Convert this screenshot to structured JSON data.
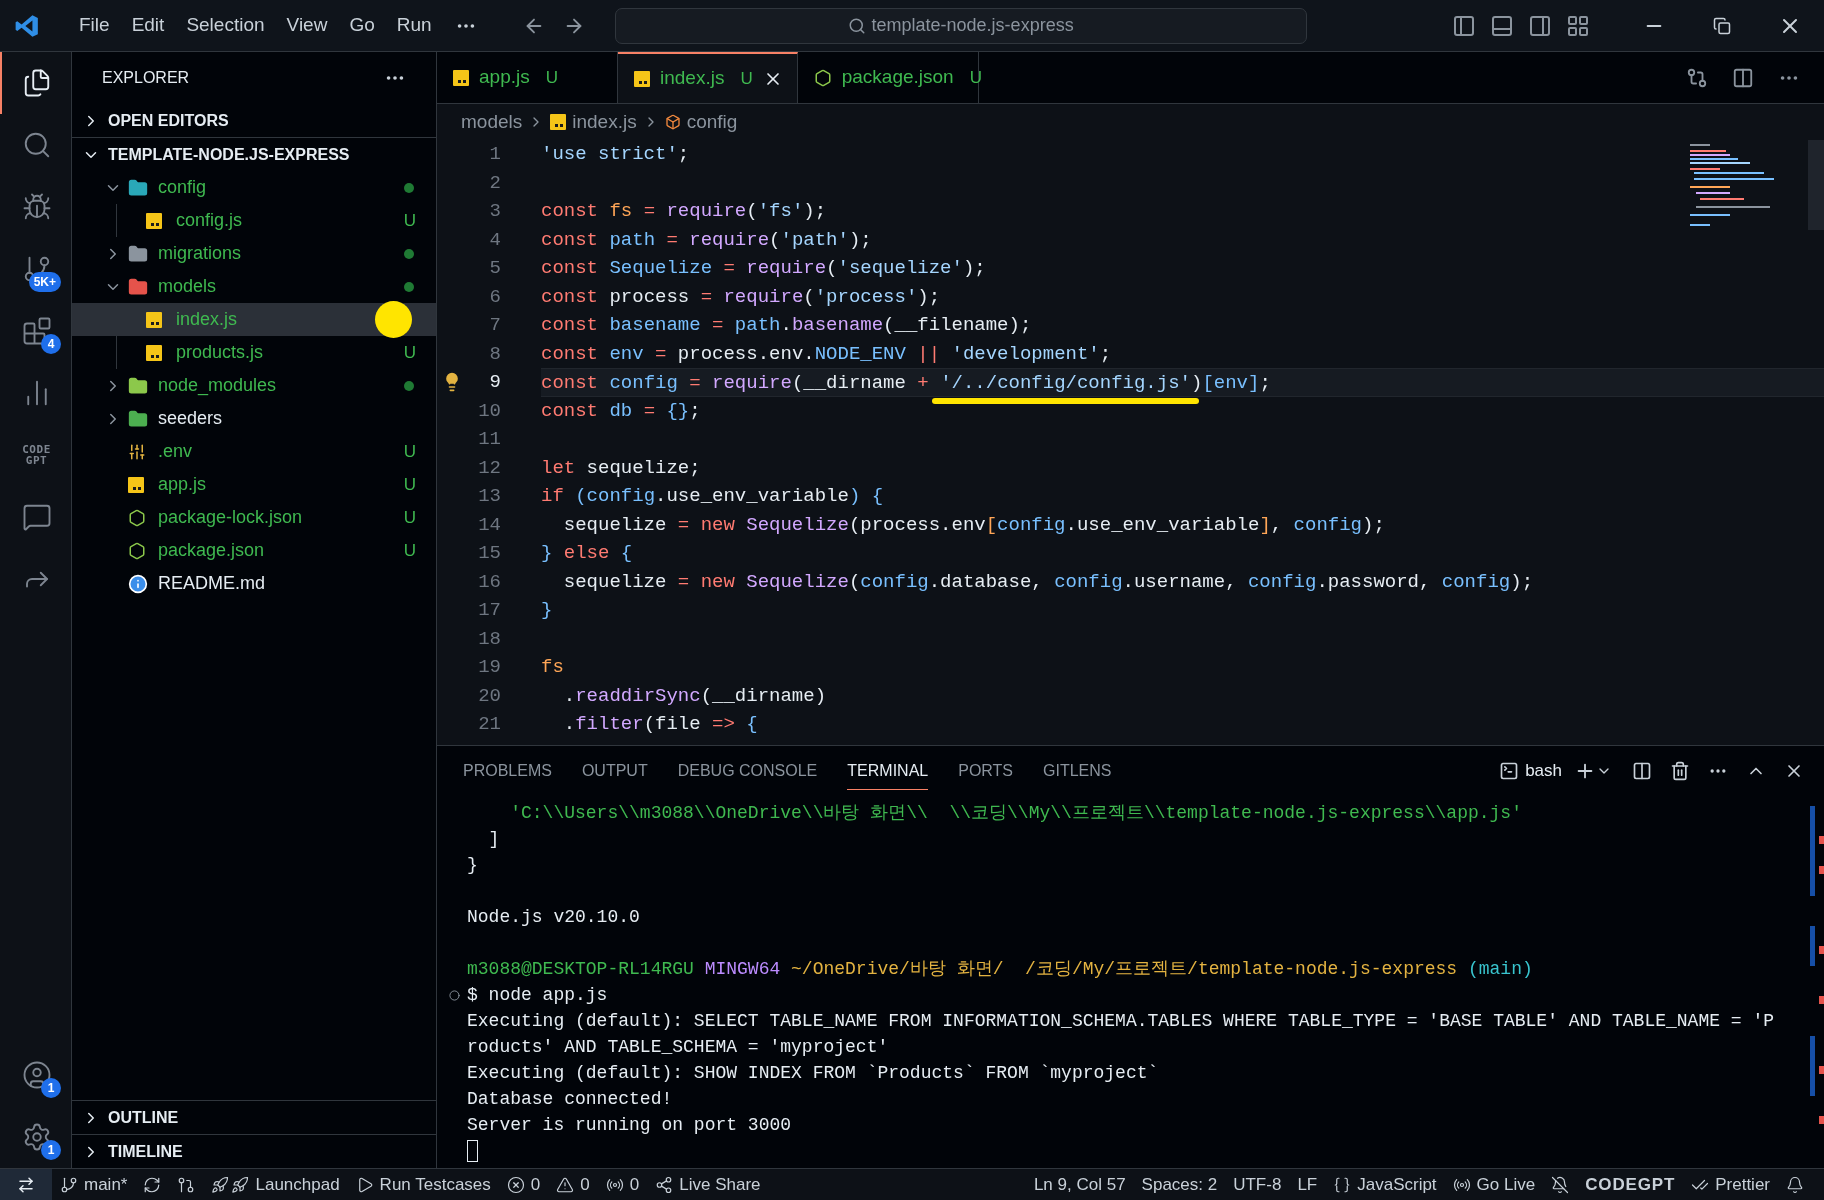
{
  "title_bar": {
    "menu": [
      "File",
      "Edit",
      "Selection",
      "View",
      "Go",
      "Run"
    ],
    "command_center": "template-node.js-express"
  },
  "activity_bar": {
    "top": [
      {
        "kind": "files",
        "selected": true
      },
      {
        "kind": "search",
        "selected": false
      },
      {
        "kind": "run-debug",
        "selected": false
      },
      {
        "kind": "source-control",
        "selected": false,
        "badge": "5K+"
      },
      {
        "kind": "extensions",
        "selected": false,
        "badge": "4"
      },
      {
        "kind": "chart",
        "selected": false
      },
      {
        "kind": "text-logo",
        "selected": false,
        "label": "CODE GPT"
      },
      {
        "kind": "chat",
        "selected": false
      },
      {
        "kind": "share",
        "selected": false
      }
    ],
    "bottom": [
      {
        "kind": "account",
        "selected": false,
        "badge": "1"
      },
      {
        "kind": "settings",
        "selected": false,
        "badge": "1"
      }
    ]
  },
  "sidebar": {
    "title": "EXPLORER",
    "sections": [
      {
        "title": "OPEN EDITORS",
        "expanded": false
      },
      {
        "title": "TEMPLATE-NODE.JS-EXPRESS",
        "expanded": true,
        "children": [
          {
            "name": "config",
            "kind": "folder-config",
            "untracked": true,
            "dot": true,
            "expanded": true,
            "selected": false,
            "children": [
              {
                "name": "config.js",
                "kind": "js",
                "untracked": true,
                "badge": "U",
                "selected": false
              }
            ]
          },
          {
            "name": "migrations",
            "kind": "folder",
            "untracked": true,
            "dot": true,
            "expanded": false,
            "selected": false
          },
          {
            "name": "models",
            "kind": "folder-models",
            "untracked": true,
            "dot": true,
            "expanded": true,
            "selected": false,
            "children": [
              {
                "name": "index.js",
                "kind": "js",
                "untracked": true,
                "selected": true,
                "annotated": true
              },
              {
                "name": "products.js",
                "kind": "js",
                "untracked": true,
                "badge": "U",
                "selected": false
              }
            ]
          },
          {
            "name": "node_modules",
            "kind": "folder-node",
            "untracked": true,
            "dot": true,
            "expanded": false,
            "selected": false
          },
          {
            "name": "seeders",
            "kind": "folder-seeders",
            "untracked": false,
            "expanded": false,
            "selected": false
          },
          {
            "name": ".env",
            "kind": "env",
            "untracked": true,
            "badge": "U",
            "selected": false
          },
          {
            "name": "app.js",
            "kind": "js",
            "untracked": true,
            "badge": "U",
            "selected": false
          },
          {
            "name": "package-lock.json",
            "kind": "json-node",
            "untracked": true,
            "badge": "U",
            "selected": false
          },
          {
            "name": "package.json",
            "kind": "json-node",
            "untracked": true,
            "badge": "U",
            "selected": false
          },
          {
            "name": "README.md",
            "kind": "info",
            "untracked": false,
            "selected": false
          }
        ]
      }
    ],
    "bottom_sections": [
      {
        "title": "OUTLINE",
        "expanded": false
      },
      {
        "title": "TIMELINE",
        "expanded": false
      }
    ]
  },
  "editor": {
    "tabs": [
      {
        "label": "app.js",
        "kind": "js",
        "badge": "U",
        "selected": false
      },
      {
        "label": "index.js",
        "kind": "js",
        "badge": "U",
        "selected": true
      },
      {
        "label": "package.json",
        "kind": "json-node",
        "badge": "U",
        "selected": false
      }
    ],
    "breadcrumb": [
      {
        "kind": "folder",
        "text": "models"
      },
      {
        "kind": "js",
        "text": "index.js"
      },
      {
        "kind": "symbol",
        "text": "config"
      }
    ],
    "lines": [
      {
        "number": "1",
        "current": false,
        "tokens": [
          {
            "kind": "str",
            "text": "'use strict'"
          },
          {
            "kind": "text",
            "text": ";"
          }
        ]
      },
      {
        "number": "2",
        "current": false
      },
      {
        "number": "3",
        "current": false,
        "tokens": [
          {
            "kind": "kw",
            "text": "const "
          },
          {
            "kind": "orange",
            "text": "fs"
          },
          {
            "kind": "kw",
            "text": " = "
          },
          {
            "kind": "fn",
            "text": "require"
          },
          {
            "kind": "text",
            "text": "("
          },
          {
            "kind": "str",
            "text": "'fs'"
          },
          {
            "kind": "text",
            "text": ");"
          }
        ]
      },
      {
        "number": "4",
        "current": false,
        "tokens": [
          {
            "kind": "kw",
            "text": "const "
          },
          {
            "kind": "var",
            "text": "path"
          },
          {
            "kind": "kw",
            "text": " = "
          },
          {
            "kind": "fn",
            "text": "require"
          },
          {
            "kind": "text",
            "text": "("
          },
          {
            "kind": "str",
            "text": "'path'"
          },
          {
            "kind": "text",
            "text": ");"
          }
        ]
      },
      {
        "number": "5",
        "current": false,
        "tokens": [
          {
            "kind": "kw",
            "text": "const "
          },
          {
            "kind": "var",
            "text": "Sequelize"
          },
          {
            "kind": "kw",
            "text": " = "
          },
          {
            "kind": "fn",
            "text": "require"
          },
          {
            "kind": "text",
            "text": "("
          },
          {
            "kind": "str",
            "text": "'sequelize'"
          },
          {
            "kind": "text",
            "text": ");"
          }
        ]
      },
      {
        "number": "6",
        "current": false,
        "tokens": [
          {
            "kind": "kw",
            "text": "const "
          },
          {
            "kind": "text",
            "text": "process"
          },
          {
            "kind": "kw",
            "text": " = "
          },
          {
            "kind": "fn",
            "text": "require"
          },
          {
            "kind": "text",
            "text": "("
          },
          {
            "kind": "str",
            "text": "'process'"
          },
          {
            "kind": "text",
            "text": ");"
          }
        ]
      },
      {
        "number": "7",
        "current": false,
        "tokens": [
          {
            "kind": "kw",
            "text": "const "
          },
          {
            "kind": "var",
            "text": "basename"
          },
          {
            "kind": "kw",
            "text": " = "
          },
          {
            "kind": "var",
            "text": "path"
          },
          {
            "kind": "text",
            "text": "."
          },
          {
            "kind": "fn",
            "text": "basename"
          },
          {
            "kind": "text",
            "text": "(__filename);"
          }
        ]
      },
      {
        "number": "8",
        "current": false,
        "tokens": [
          {
            "kind": "kw",
            "text": "const "
          },
          {
            "kind": "var",
            "text": "env"
          },
          {
            "kind": "kw",
            "text": " = "
          },
          {
            "kind": "text",
            "text": "process.env."
          },
          {
            "kind": "var",
            "text": "NODE_ENV"
          },
          {
            "kind": "kw",
            "text": " || "
          },
          {
            "kind": "str",
            "text": "'development'"
          },
          {
            "kind": "text",
            "text": ";"
          }
        ]
      },
      {
        "number": "9",
        "current": true,
        "lightbulb": true,
        "tokens": [
          {
            "kind": "kw",
            "text": "const "
          },
          {
            "kind": "var",
            "text": "config"
          },
          {
            "kind": "kw",
            "text": " = "
          },
          {
            "kind": "fn",
            "text": "require"
          },
          {
            "kind": "text",
            "text": "(__dirname "
          },
          {
            "kind": "kw",
            "text": "+ "
          },
          {
            "kind": "str",
            "text": "'/../config/config.js'",
            "annotated": true
          },
          {
            "kind": "text",
            "text": ")"
          },
          {
            "kind": "var",
            "text": "[env]"
          },
          {
            "kind": "text",
            "text": ";"
          }
        ]
      },
      {
        "number": "10",
        "current": false,
        "tokens": [
          {
            "kind": "kw",
            "text": "const "
          },
          {
            "kind": "var",
            "text": "db"
          },
          {
            "kind": "kw",
            "text": " = "
          },
          {
            "kind": "var",
            "text": "{}"
          },
          {
            "kind": "text",
            "text": ";"
          }
        ]
      },
      {
        "number": "11",
        "current": false
      },
      {
        "number": "12",
        "current": false,
        "tokens": [
          {
            "kind": "kw",
            "text": "let "
          },
          {
            "kind": "text",
            "text": "sequelize;"
          }
        ]
      },
      {
        "number": "13",
        "current": false,
        "tokens": [
          {
            "kind": "kw",
            "text": "if "
          },
          {
            "kind": "var",
            "text": "(config"
          },
          {
            "kind": "text",
            "text": ".use_env_variable"
          },
          {
            "kind": "var",
            "text": ") {"
          }
        ]
      },
      {
        "number": "14",
        "current": false,
        "tokens": [
          {
            "kind": "text",
            "text": "  sequelize "
          },
          {
            "kind": "kw",
            "text": "= new "
          },
          {
            "kind": "fn",
            "text": "Sequelize"
          },
          {
            "kind": "text",
            "text": "(process.env"
          },
          {
            "kind": "orange",
            "text": "["
          },
          {
            "kind": "var",
            "text": "config"
          },
          {
            "kind": "text",
            "text": ".use_env_variable"
          },
          {
            "kind": "orange",
            "text": "]"
          },
          {
            "kind": "text",
            "text": ", "
          },
          {
            "kind": "var",
            "text": "config"
          },
          {
            "kind": "text",
            "text": ");"
          }
        ]
      },
      {
        "number": "15",
        "current": false,
        "tokens": [
          {
            "kind": "var",
            "text": "} "
          },
          {
            "kind": "kw",
            "text": "else "
          },
          {
            "kind": "var",
            "text": "{"
          }
        ]
      },
      {
        "number": "16",
        "current": false,
        "tokens": [
          {
            "kind": "text",
            "text": "  sequelize "
          },
          {
            "kind": "kw",
            "text": "= new "
          },
          {
            "kind": "fn",
            "text": "Sequelize"
          },
          {
            "kind": "text",
            "text": "("
          },
          {
            "kind": "var",
            "text": "config"
          },
          {
            "kind": "text",
            "text": ".database, "
          },
          {
            "kind": "var",
            "text": "config"
          },
          {
            "kind": "text",
            "text": ".username, "
          },
          {
            "kind": "var",
            "text": "config"
          },
          {
            "kind": "text",
            "text": ".password, "
          },
          {
            "kind": "var",
            "text": "config"
          },
          {
            "kind": "text",
            "text": ");"
          }
        ]
      },
      {
        "number": "17",
        "current": false,
        "tokens": [
          {
            "kind": "var",
            "text": "}"
          }
        ]
      },
      {
        "number": "18",
        "current": false
      },
      {
        "number": "19",
        "current": false,
        "tokens": [
          {
            "kind": "orange",
            "text": "fs"
          }
        ]
      },
      {
        "number": "20",
        "current": false,
        "tokens": [
          {
            "kind": "text",
            "text": "  ."
          },
          {
            "kind": "fn",
            "text": "readdirSync"
          },
          {
            "kind": "text",
            "text": "(__dirname)"
          }
        ]
      },
      {
        "number": "21",
        "current": false,
        "tokens": [
          {
            "kind": "text",
            "text": "  ."
          },
          {
            "kind": "fn",
            "text": "filter"
          },
          {
            "kind": "text",
            "text": "(file "
          },
          {
            "kind": "kw",
            "text": "=>"
          },
          {
            "kind": "var",
            "text": " {"
          }
        ]
      }
    ]
  },
  "panel": {
    "tabs": [
      {
        "label": "PROBLEMS",
        "selected": false
      },
      {
        "label": "OUTPUT",
        "selected": false
      },
      {
        "label": "DEBUG CONSOLE",
        "selected": false
      },
      {
        "label": "TERMINAL",
        "selected": true
      },
      {
        "label": "PORTS",
        "selected": false
      },
      {
        "label": "GITLENS",
        "selected": false
      }
    ],
    "terminal_name": "bash",
    "lines": [
      {
        "kind": "output",
        "segments": [
          {
            "kind": "green",
            "text": "    'C:\\\\Users\\\\m3088\\\\OneDrive\\\\바탕 화면\\\\  \\\\코딩\\\\My\\\\프로젝트\\\\template-node.js-express\\\\app.js'"
          }
        ]
      },
      {
        "kind": "output",
        "segments": [
          {
            "kind": "text",
            "text": "  ]"
          }
        ]
      },
      {
        "kind": "output",
        "segments": [
          {
            "kind": "text",
            "text": "}"
          }
        ]
      },
      {
        "kind": "blank"
      },
      {
        "kind": "output",
        "segments": [
          {
            "kind": "text",
            "text": "Node.js v20.10.0"
          }
        ]
      },
      {
        "kind": "blank"
      },
      {
        "kind": "output",
        "segments": [
          {
            "kind": "green",
            "text": "m3088@DESKTOP-RL14RGU "
          },
          {
            "kind": "purple",
            "text": "MINGW64 "
          },
          {
            "kind": "orange",
            "text": "~/OneDrive/바탕 화면/  /코딩/My/프로젝트/template-node.js-express"
          },
          {
            "kind": "cyan",
            "text": " (main)"
          }
        ]
      },
      {
        "kind": "command",
        "segments": [
          {
            "kind": "text",
            "text": "$ node app.js"
          }
        ]
      },
      {
        "kind": "output",
        "segments": [
          {
            "kind": "text",
            "text": "Executing (default): SELECT TABLE_NAME FROM INFORMATION_SCHEMA.TABLES WHERE TABLE_TYPE = 'BASE TABLE' AND TABLE_NAME = 'P"
          }
        ]
      },
      {
        "kind": "output",
        "segments": [
          {
            "kind": "text",
            "text": "roducts' AND TABLE_SCHEMA = 'myproject'"
          }
        ]
      },
      {
        "kind": "output",
        "segments": [
          {
            "kind": "text",
            "text": "Executing (default): SHOW INDEX FROM `Products` FROM `myproject`"
          }
        ]
      },
      {
        "kind": "output",
        "segments": [
          {
            "kind": "text",
            "text": "Database connected!"
          }
        ]
      },
      {
        "kind": "output",
        "segments": [
          {
            "kind": "text",
            "text": "Server is running on port 3000"
          }
        ]
      },
      {
        "kind": "cursor"
      }
    ]
  },
  "status_bar": {
    "left": [
      {
        "kind": "remote"
      },
      {
        "kind": "branch",
        "text": "main*"
      },
      {
        "kind": "sync"
      },
      {
        "kind": "pull-request"
      },
      {
        "kind": "launchpad",
        "text": "Launchpad"
      },
      {
        "kind": "play",
        "text": "Run Testcases"
      },
      {
        "kind": "error",
        "text": "0"
      },
      {
        "kind": "warning",
        "text": "0"
      },
      {
        "kind": "broadcast",
        "text": "0"
      },
      {
        "kind": "live-share",
        "text": "Live Share"
      }
    ],
    "right": [
      {
        "kind": "plain",
        "text": "Ln 9, Col 57"
      },
      {
        "kind": "plain",
        "text": "Spaces: 2"
      },
      {
        "kind": "plain",
        "text": "UTF-8"
      },
      {
        "kind": "plain",
        "text": "LF"
      },
      {
        "kind": "braces",
        "text": "JavaScript"
      },
      {
        "kind": "radio",
        "text": "Go Live"
      },
      {
        "kind": "bell-off"
      },
      {
        "kind": "logo",
        "text": "CODEGPT"
      },
      {
        "kind": "check-check",
        "text": "Prettier"
      },
      {
        "kind": "bell"
      }
    ]
  }
}
